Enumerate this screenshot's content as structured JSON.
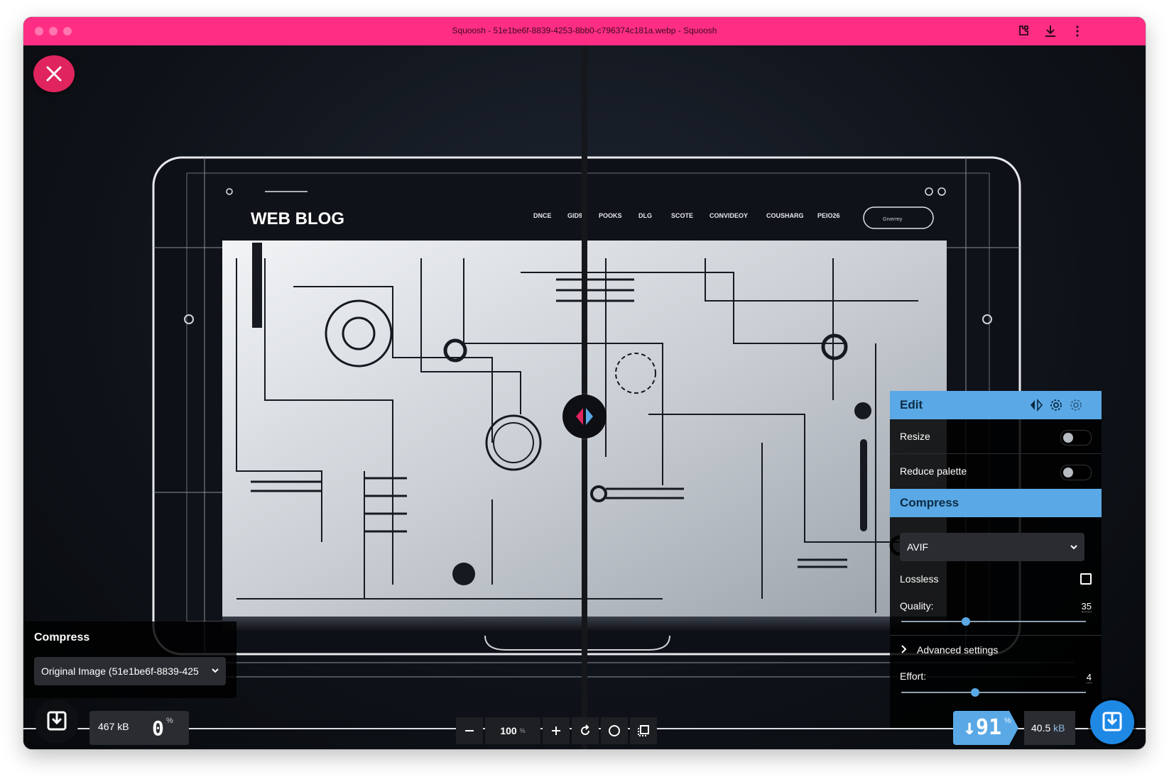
{
  "window": {
    "title": "Squoosh - 51e1be6f-8839-4253-8bb0-c796374c181a.webp - Squoosh",
    "accent": "#ff2e84"
  },
  "preview": {
    "image_text": {
      "brand": "WEB BLOG",
      "nav_items": [
        "DNCE",
        "GID9",
        "POOKS",
        "DLG",
        "SCOTE",
        "CONVIDEOY",
        "COUSHARG",
        "PEIO26"
      ],
      "button": "Grverrey"
    }
  },
  "left_panel": {
    "heading": "Compress",
    "source_select": "Original Image (51e1be6f-8839-425",
    "size": "467 kB",
    "percent": "0",
    "percent_symbol": "%"
  },
  "toolbar": {
    "zoom_value": "100",
    "zoom_unit": "%"
  },
  "right_panel": {
    "edit_header": "Edit",
    "resize_label": "Resize",
    "resize_enabled": false,
    "reduce_palette_label": "Reduce palette",
    "reduce_palette_enabled": false,
    "compress_header": "Compress",
    "format": "AVIF",
    "lossless_label": "Lossless",
    "lossless_checked": false,
    "quality_label": "Quality:",
    "quality_value": "35",
    "quality_level": 0.35,
    "advanced_label": "Advanced settings",
    "effort_label": "Effort:",
    "effort_value": "4",
    "effort_level": 0.4,
    "savings_percent": "↓91",
    "savings_symbol": "%",
    "result_size": "40.5",
    "result_unit": "kB",
    "accent": "#5aa9e6"
  },
  "icons": {
    "titlebar": [
      "extension-icon",
      "download-icon",
      "more-vert-icon"
    ],
    "header_tools": [
      "flip-icon",
      "settings-icon",
      "settings-gear-icon"
    ],
    "toolbar": [
      "minus-icon",
      "plus-icon",
      "rotate-icon",
      "circle-icon",
      "crop-icon"
    ]
  }
}
